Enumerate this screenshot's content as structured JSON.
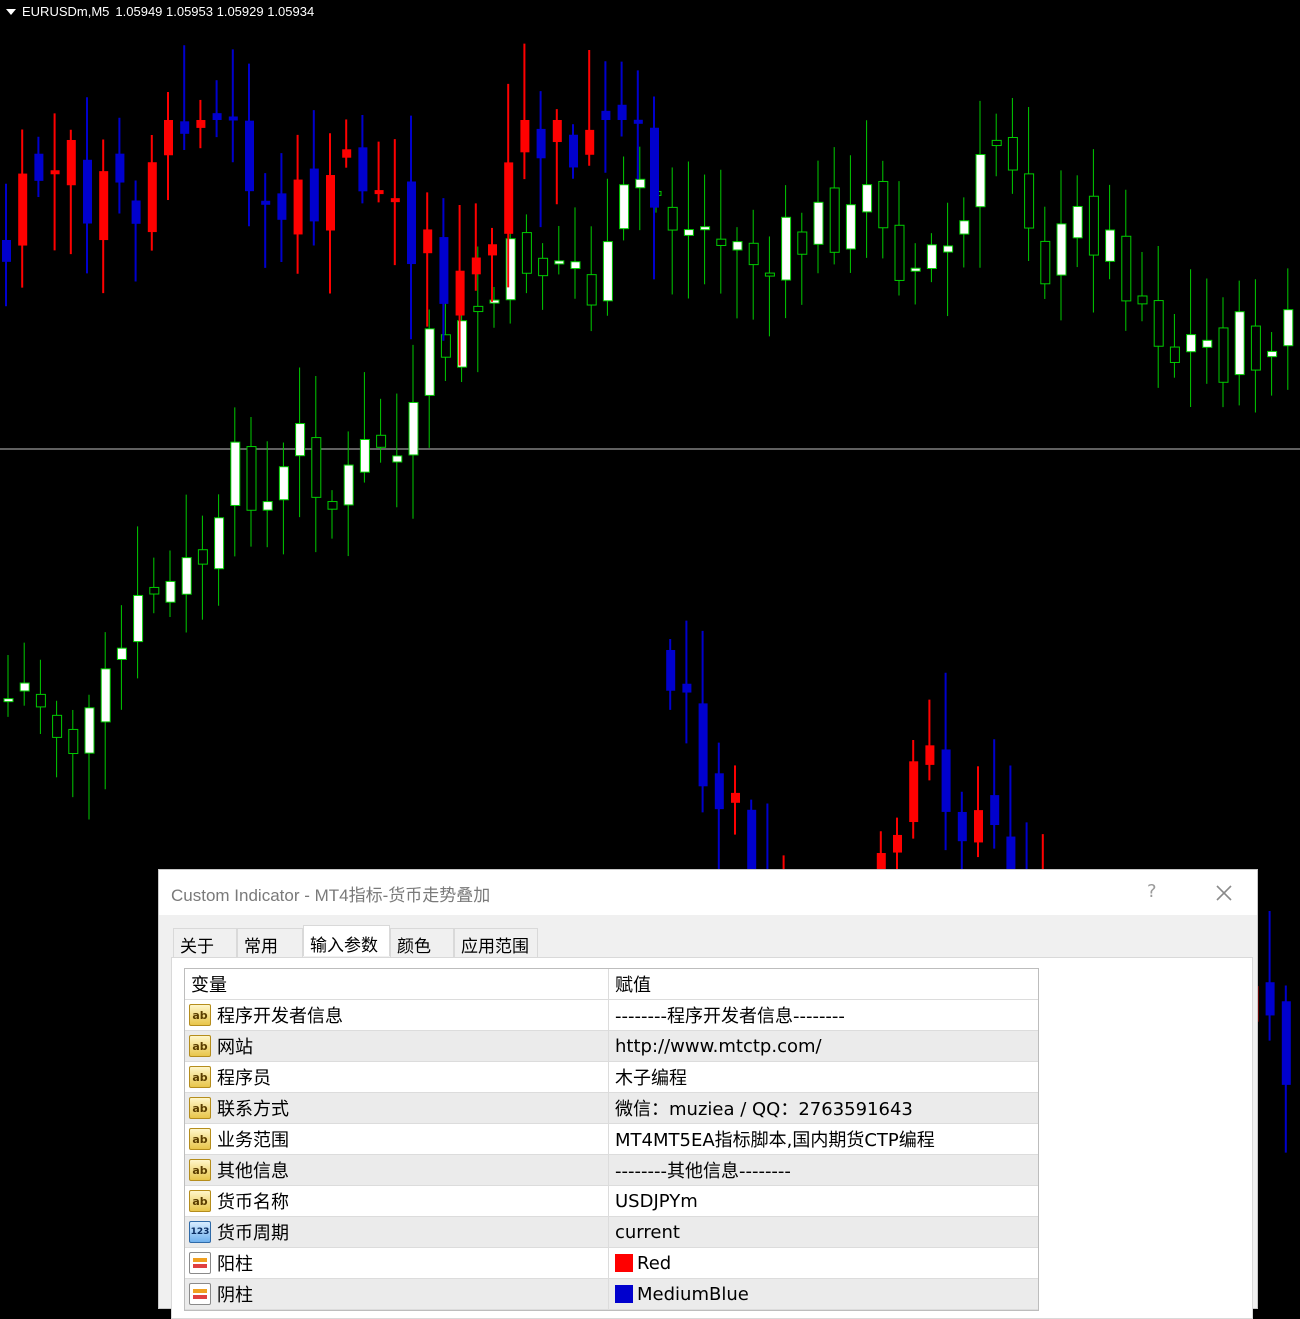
{
  "chart_header": {
    "symbol": "EURUSDm,M5",
    "ohlc": "1.05949 1.05953 1.05929 1.05934"
  },
  "colors": {
    "up_primary": "#FF0000",
    "down_primary": "#0000CD",
    "up_secondary": "#FFFFFF",
    "down_secondary": "#000000",
    "wick_secondary": "#00CC00",
    "background": "#000000",
    "grid_line": "#BFBFBF"
  },
  "dialog": {
    "title": "Custom Indicator - MT4指标-货币走势叠加",
    "help_label": "?",
    "tabs": [
      {
        "label": "关于"
      },
      {
        "label": "常用"
      },
      {
        "label": "输入参数"
      },
      {
        "label": "颜色"
      },
      {
        "label": "应用范围"
      }
    ],
    "active_tab": "输入参数",
    "columns": {
      "variable": "变量",
      "value": "赋值"
    },
    "params": [
      {
        "type": "ab",
        "name": "程序开发者信息",
        "value": "--------程序开发者信息--------"
      },
      {
        "type": "ab",
        "name": "网站",
        "value": "http://www.mtctp.com/"
      },
      {
        "type": "ab",
        "name": "程序员",
        "value": "木子编程"
      },
      {
        "type": "ab",
        "name": "联系方式",
        "value": "微信：muziea / QQ：2763591643"
      },
      {
        "type": "ab",
        "name": "业务范围",
        "value": "MT4MT5EA指标脚本,国内期货CTP编程"
      },
      {
        "type": "ab",
        "name": "其他信息",
        "value": "--------其他信息--------"
      },
      {
        "type": "ab",
        "name": "货币名称",
        "value": "USDJPYm"
      },
      {
        "type": "123",
        "name": "货币周期",
        "value": "current"
      },
      {
        "type": "color",
        "name": "阳柱",
        "value": "Red",
        "swatch": "#FF0000"
      },
      {
        "type": "color",
        "name": "阴柱",
        "value": "MediumBlue",
        "swatch": "#0000CD"
      }
    ]
  }
}
